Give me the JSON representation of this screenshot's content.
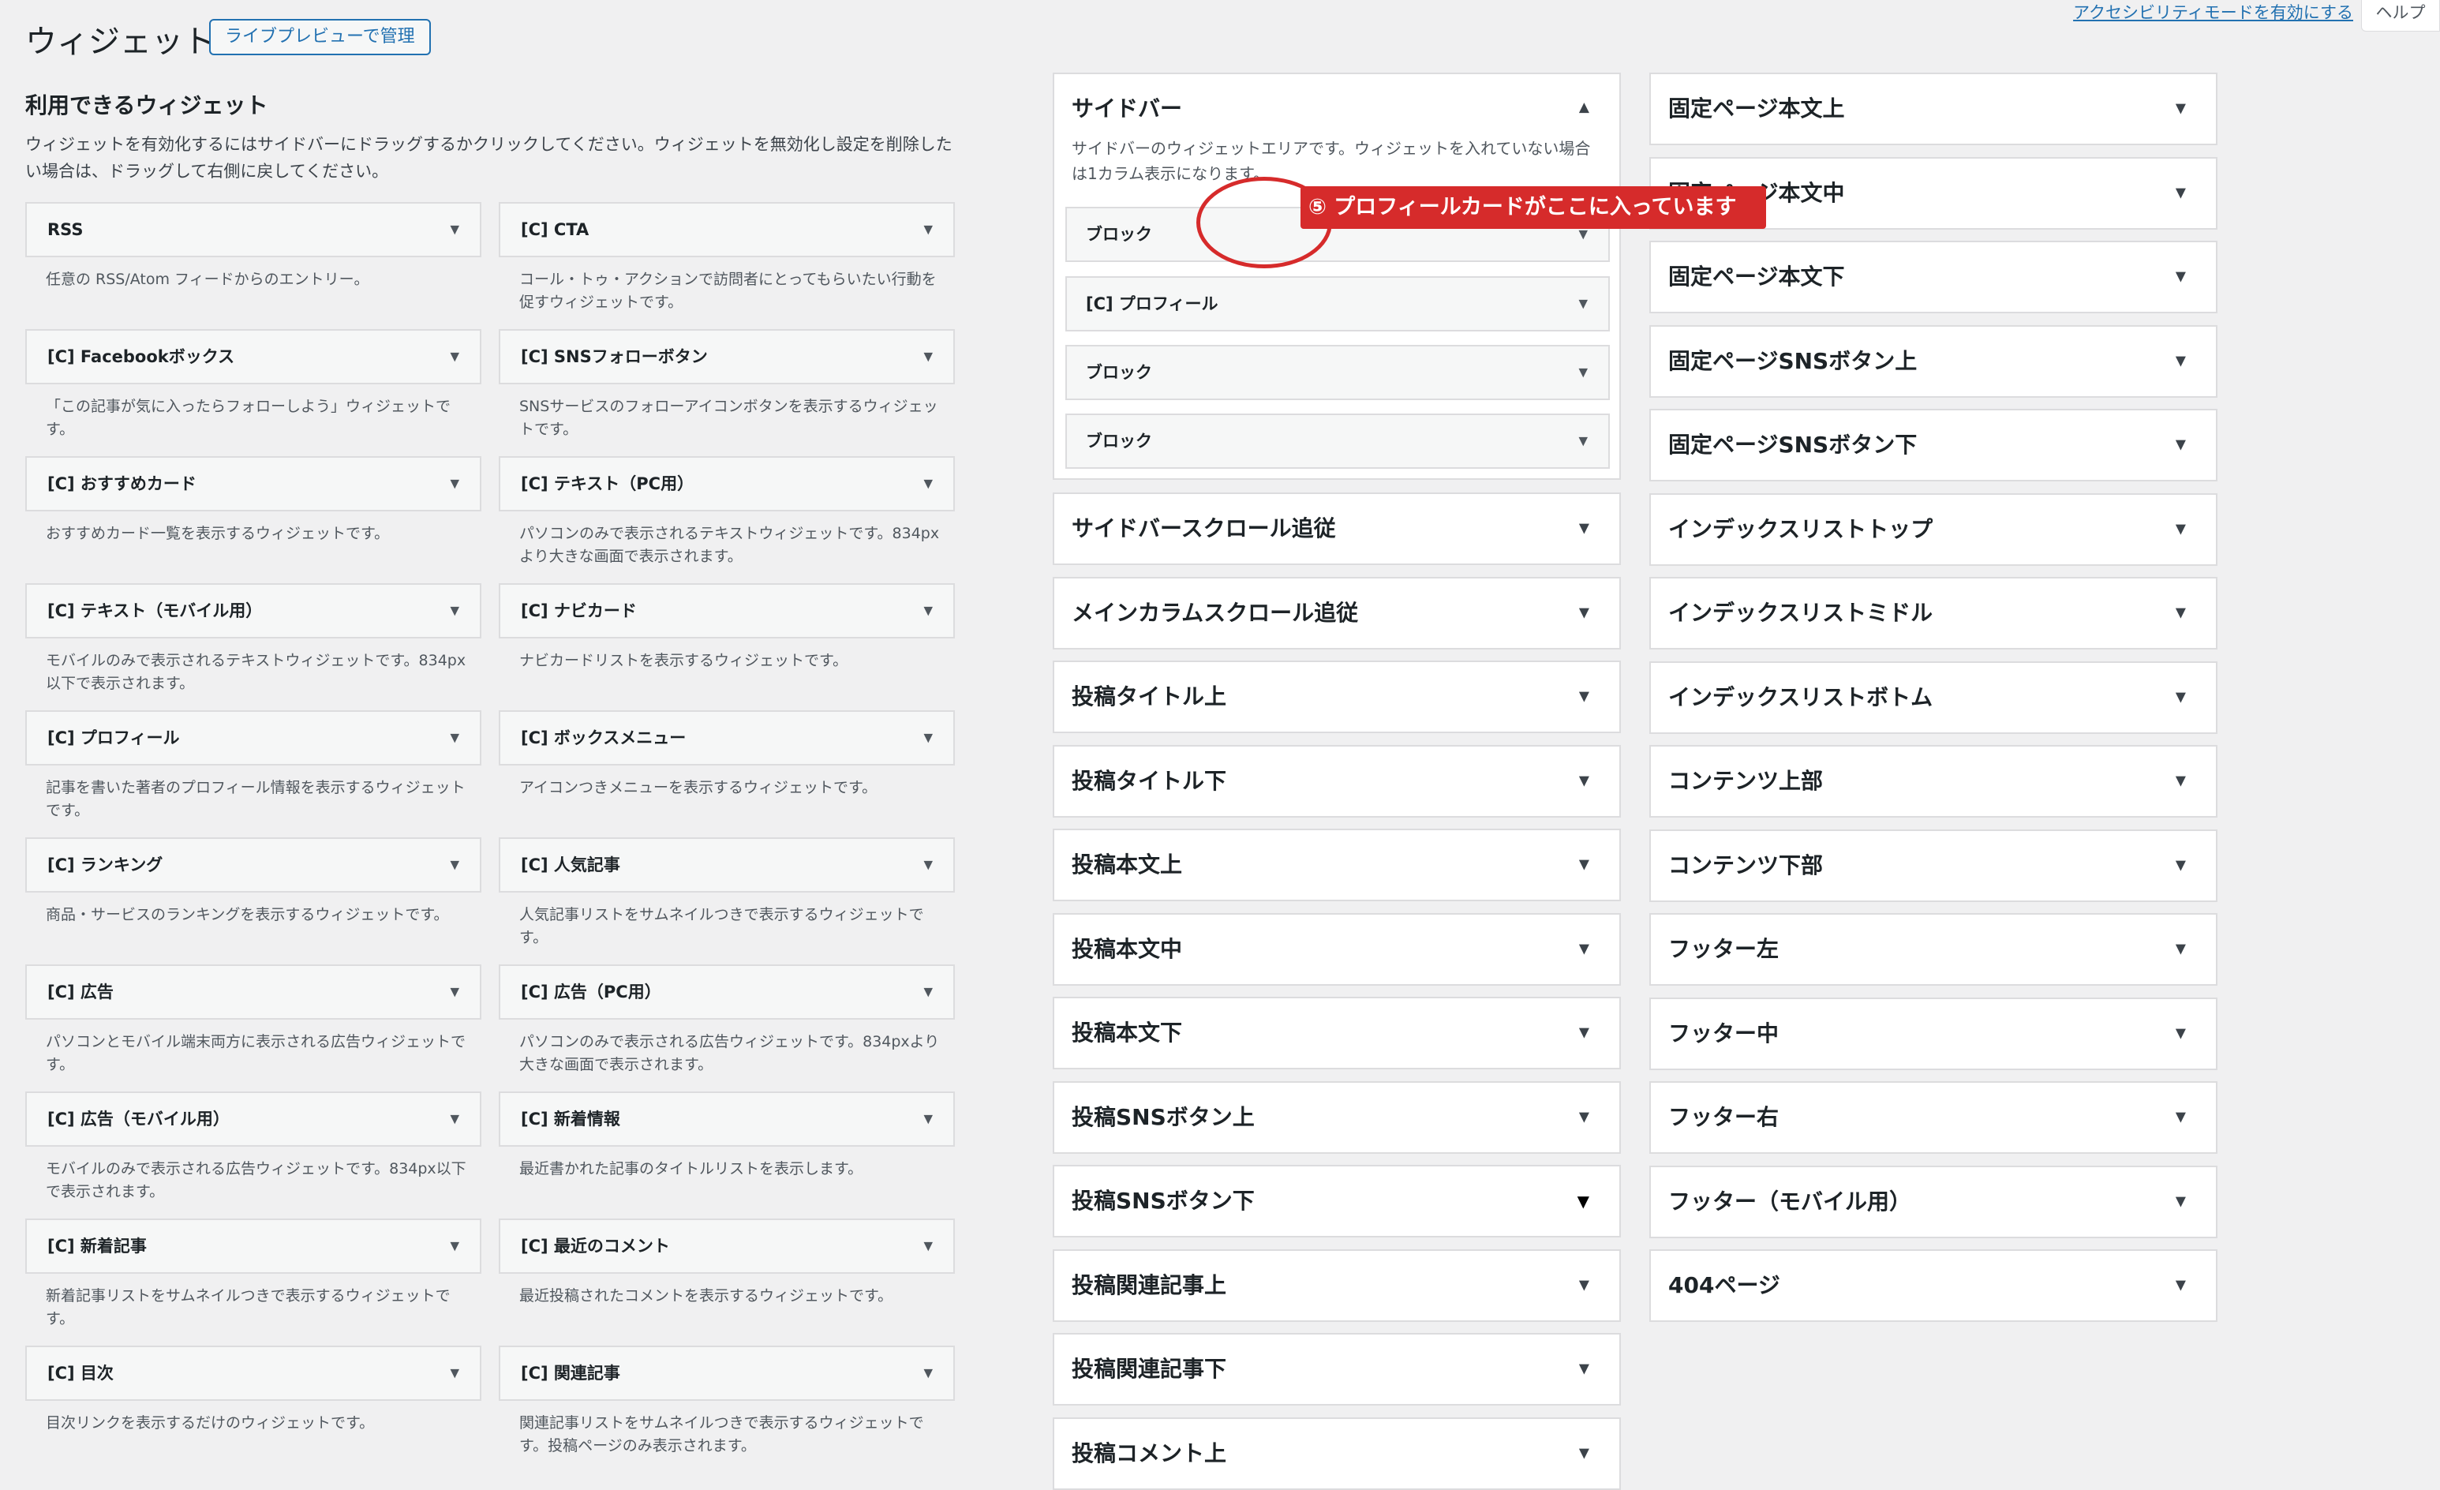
{
  "header": {
    "title": "ウィジェット",
    "manage_button": "ライブプレビューで管理",
    "accessibility_link": "アクセシビリティモードを有効にする",
    "help_tab": "ヘルプ"
  },
  "available": {
    "title": "利用できるウィジェット",
    "description": "ウィジェットを有効化するにはサイドバーにドラッグするかクリックしてください。ウィジェットを無効化し設定を削除したい場合は、ドラッグして右側に戻してください。",
    "widgets": [
      {
        "name": "RSS",
        "desc": "任意の RSS/Atom フィードからのエントリー。"
      },
      {
        "name": "[C] CTA",
        "desc": "コール・トゥ・アクションで訪問者にとってもらいたい行動を促すウィジェットです。"
      },
      {
        "name": "[C] Facebookボックス",
        "desc": "「この記事が気に入ったらフォローしよう」ウィジェットです。"
      },
      {
        "name": "[C] SNSフォローボタン",
        "desc": "SNSサービスのフォローアイコンボタンを表示するウィジェットです。"
      },
      {
        "name": "[C] おすすめカード",
        "desc": "おすすめカード一覧を表示するウィジェットです。"
      },
      {
        "name": "[C] テキスト（PC用）",
        "desc": "パソコンのみで表示されるテキストウィジェットです。834pxより大きな画面で表示されます。"
      },
      {
        "name": "[C] テキスト（モバイル用）",
        "desc": "モバイルのみで表示されるテキストウィジェットです。834px以下で表示されます。"
      },
      {
        "name": "[C] ナビカード",
        "desc": "ナビカードリストを表示するウィジェットです。"
      },
      {
        "name": "[C] プロフィール",
        "desc": "記事を書いた著者のプロフィール情報を表示するウィジェットです。"
      },
      {
        "name": "[C] ボックスメニュー",
        "desc": "アイコンつきメニューを表示するウィジェットです。"
      },
      {
        "name": "[C] ランキング",
        "desc": "商品・サービスのランキングを表示するウィジェットです。"
      },
      {
        "name": "[C] 人気記事",
        "desc": "人気記事リストをサムネイルつきで表示するウィジェットです。"
      },
      {
        "name": "[C] 広告",
        "desc": "パソコンとモバイル端末両方に表示される広告ウィジェットです。"
      },
      {
        "name": "[C] 広告（PC用）",
        "desc": "パソコンのみで表示される広告ウィジェットです。834pxより大きな画面で表示されます。"
      },
      {
        "name": "[C] 広告（モバイル用）",
        "desc": "モバイルのみで表示される広告ウィジェットです。834px以下で表示されます。"
      },
      {
        "name": "[C] 新着情報",
        "desc": "最近書かれた記事のタイトルリストを表示します。"
      },
      {
        "name": "[C] 新着記事",
        "desc": "新着記事リストをサムネイルつきで表示するウィジェットです。"
      },
      {
        "name": "[C] 最近のコメント",
        "desc": "最近投稿されたコメントを表示するウィジェットです。"
      },
      {
        "name": "[C] 目次",
        "desc": "目次リンクを表示するだけのウィジェットです。"
      },
      {
        "name": "[C] 関連記事",
        "desc": "関連記事リストをサムネイルつきで表示するウィジェットです。投稿ページのみ表示されます。"
      }
    ]
  },
  "sidebar": {
    "title": "サイドバー",
    "description": "サイドバーのウィジェットエリアです。ウィジェットを入れていない場合は1カラム表示になります。",
    "blocks": [
      "ブロック",
      "[C] プロフィール",
      "ブロック",
      "ブロック"
    ]
  },
  "areas_col1": [
    "サイドバースクロール追従",
    "メインカラムスクロール追従",
    "投稿タイトル上",
    "投稿タイトル下",
    "投稿本文上",
    "投稿本文中",
    "投稿本文下",
    "投稿SNSボタン上",
    "投稿SNSボタン下",
    "投稿関連記事上",
    "投稿関連記事下",
    "投稿コメント上"
  ],
  "areas_col2": [
    "固定ページ本文上",
    "固定ページ本文中",
    "固定ページ本文下",
    "固定ページSNSボタン上",
    "固定ページSNSボタン下",
    "インデックスリストトップ",
    "インデックスリストミドル",
    "インデックスリストボトム",
    "コンテンツ上部",
    "コンテンツ下部",
    "フッター左",
    "フッター中",
    "フッター右",
    "フッター（モバイル用）",
    "404ページ"
  ],
  "annotation": {
    "label": "⑤ プロフィールカードがここに入っています"
  },
  "icons": {
    "collapse": "triangle-down-icon",
    "expand": "triangle-up-icon"
  }
}
